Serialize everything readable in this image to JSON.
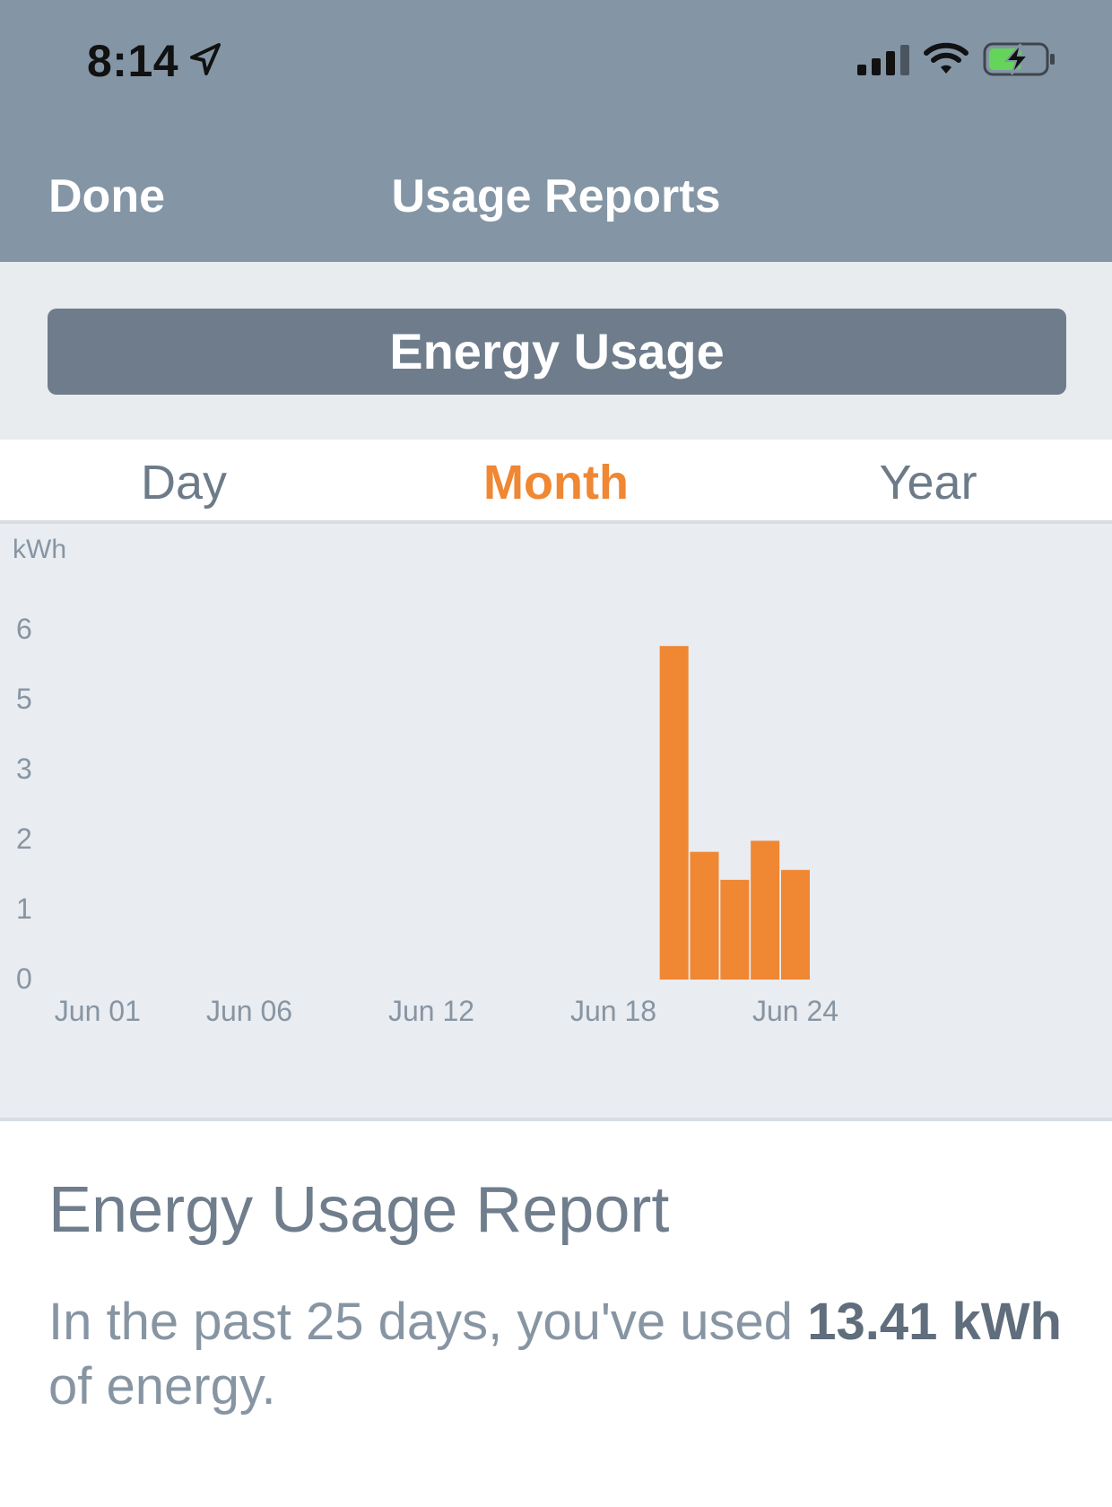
{
  "status_bar": {
    "time": "8:14",
    "icons": [
      "location-arrow-icon",
      "signal-bars-icon",
      "wifi-icon",
      "battery-charging-icon"
    ],
    "battery_color": "#64d55a"
  },
  "nav": {
    "done_label": "Done",
    "title": "Usage Reports"
  },
  "energy_button": {
    "label": "Energy Usage"
  },
  "tabs": [
    {
      "label": "Day",
      "selected": false
    },
    {
      "label": "Month",
      "selected": true
    },
    {
      "label": "Year",
      "selected": false
    }
  ],
  "colors": {
    "header": "#8495a5",
    "accent": "#ef8733",
    "button": "#6e7c8b",
    "chart_background": "#e9ecf0"
  },
  "chart_data": {
    "type": "bar",
    "ylabel": "kWh",
    "yticks": [
      "0",
      "1",
      "2",
      "3",
      "5",
      "6"
    ],
    "ytick_values": [
      0,
      1.2,
      2.4,
      3.6,
      4.8,
      6.0
    ],
    "xtick_labels": [
      {
        "label": "Jun 01",
        "day": 1
      },
      {
        "label": "Jun 06",
        "day": 6
      },
      {
        "label": "Jun 12",
        "day": 12
      },
      {
        "label": "Jun 18",
        "day": 18
      },
      {
        "label": "Jun 24",
        "day": 24
      }
    ],
    "bars": [
      {
        "day": 20,
        "value": 5.72
      },
      {
        "day": 21,
        "value": 2.19
      },
      {
        "day": 22,
        "value": 1.71
      },
      {
        "day": 23,
        "value": 2.38
      },
      {
        "day": 24,
        "value": 1.88
      }
    ],
    "ylim": [
      0,
      6.0
    ],
    "xlim": [
      0,
      30
    ],
    "grid": false,
    "legend": "none"
  },
  "report": {
    "title": "Energy Usage Report",
    "text_prefix": "In the past 25 days, you've used ",
    "text_value": "13.41 kWh",
    "text_suffix": " of energy."
  }
}
